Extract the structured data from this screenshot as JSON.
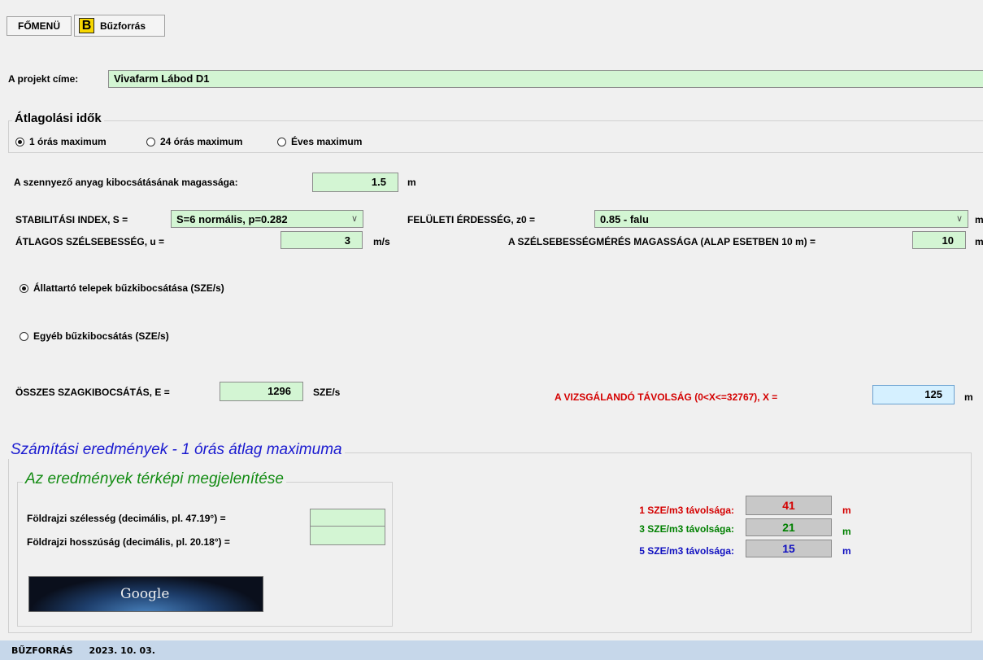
{
  "toolbar": {
    "main_menu_label": "FŐMENÜ",
    "app_icon_letter": "B",
    "app_tab_label": "Bűzforrás"
  },
  "project": {
    "label": "A projekt címe:",
    "value": "Vivafarm Lábod D1"
  },
  "averaging": {
    "title": "Átlagolási idők",
    "options": [
      "1 órás maximum",
      "24 órás maximum",
      "Éves maximum"
    ],
    "selected": "1 órás maximum"
  },
  "emission_height": {
    "label": "A szennyező anyag kibocsátásának magassága:",
    "value": "1.5",
    "unit": "m"
  },
  "stability": {
    "label": "STABILITÁSI INDEX, S =",
    "value": "S=6 normális, p=0.282"
  },
  "roughness": {
    "label": "FELÜLETI ÉRDESSÉG, z0 =",
    "value": "0.85 - falu",
    "unit": "m"
  },
  "wind_speed": {
    "label": "ÁTLAGOS SZÉLSEBESSÉG, u =",
    "value": "3",
    "unit": "m/s"
  },
  "wind_height": {
    "label": "A SZÉLSEBESSÉGMÉRÉS MAGASSÁGA (ALAP ESETBEN 10 m) =",
    "value": "10",
    "unit": "m"
  },
  "source_type": {
    "options": [
      "Állattartó telepek bűzkibocsátása (SZE/s)",
      "Egyéb bűzkibocsátás (SZE/s)"
    ],
    "selected": "Állattartó telepek bűzkibocsátása (SZE/s)"
  },
  "total_emission": {
    "label": "ÖSSZES SZAGKIBOCSÁTÁS, E =",
    "value": "1296",
    "unit": "SZE/s"
  },
  "distance": {
    "label": "A VIZSGÁLANDÓ TÁVOLSÁG (0<X<=32767), X =",
    "value": "125",
    "unit": "m"
  },
  "results": {
    "title": "Számítási eredmények - 1 órás átlag maximuma",
    "map_title": "Az eredmények térképi megjelenítése",
    "latitude_label": "Földrajzi szélesség (decimális, pl. 47.19°) =",
    "latitude_value": "",
    "longitude_label": "Földrajzi hosszúság (decimális, pl. 20.18°) =",
    "longitude_value": "",
    "google_button_label": "Google",
    "rows": [
      {
        "label": "1 SZE/m3 távolsága:",
        "value": "41",
        "unit": "m",
        "color": "#d40000"
      },
      {
        "label": "3 SZE/m3 távolsága:",
        "value": "21",
        "unit": "m",
        "color": "#008000"
      },
      {
        "label": "5 SZE/m3 távolsága:",
        "value": "15",
        "unit": "m",
        "color": "#1010c0"
      }
    ]
  },
  "statusbar": {
    "app_name": "BŰZFORRÁS",
    "date": "2023. 10. 03."
  },
  "colors": {
    "field_green": "#d3f5d3",
    "title_blue": "#1a1ad0",
    "subtitle_green": "#148c14",
    "distance_red": "#d40000",
    "statusbar": "#c6d7ea"
  }
}
